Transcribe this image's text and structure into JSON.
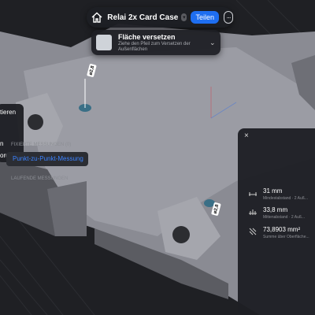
{
  "toolbar": {
    "title": "Relai 2x Card Case",
    "share_label": "Teilen",
    "more_label": "···"
  },
  "hint": {
    "title": "Fläche versetzen",
    "subtitle": "Ziehe den Pfeil zum Versetzen der Außenflächen",
    "chevron": "⌄"
  },
  "context_menu": {
    "items": [
      "tieren",
      "n",
      "orun..."
    ]
  },
  "dimensions": [
    "⌀2,8",
    "⌀2,8"
  ],
  "panel": {
    "close_label": "×",
    "fixed_header": "FIXIERTE MESSUNGEN (0)",
    "fixed_item": "Punkt-zu-Punkt-Messung",
    "running_header": "LAUFENDE MESSUNGEN",
    "measurements": [
      {
        "icon": "distance-icon",
        "value": "31 mm",
        "desc": "Mindestabstand · 2 Auß..."
      },
      {
        "icon": "center-distance-icon",
        "value": "33,8 mm",
        "desc": "Mittenabstand · 2 Auß..."
      },
      {
        "icon": "area-icon",
        "value": "73,8903 mm²",
        "desc": "Summe über Oberfläche..."
      }
    ]
  },
  "colors": {
    "accent": "#1e6ef0",
    "link": "#3b82ff",
    "part": "#8f9098",
    "background": "#1e1f23"
  }
}
